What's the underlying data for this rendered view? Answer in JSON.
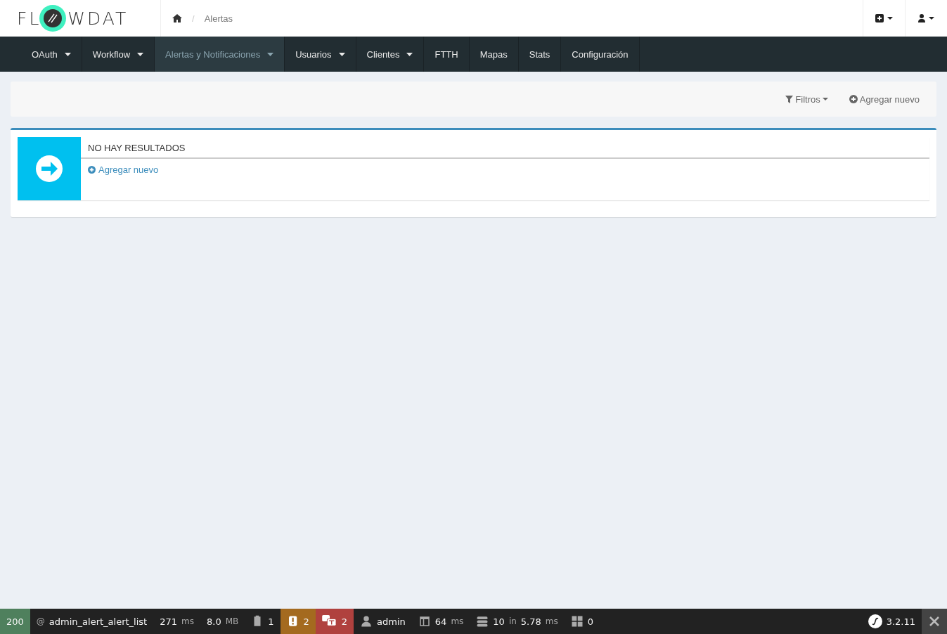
{
  "header": {
    "logo": {
      "before": "FL",
      "after": "WDAT"
    },
    "breadcrumb": [
      {
        "separator": "/",
        "label": "Alertas"
      }
    ]
  },
  "nav": [
    {
      "label": "OAuth",
      "dropdown": true,
      "selected": false
    },
    {
      "label": "Workflow",
      "dropdown": true,
      "selected": false
    },
    {
      "label": "Alertas y Notificaciones",
      "dropdown": true,
      "selected": true
    },
    {
      "label": "Usuarios",
      "dropdown": true,
      "selected": false
    },
    {
      "label": "Clientes",
      "dropdown": true,
      "selected": false
    },
    {
      "label": "FTTH",
      "dropdown": false,
      "selected": false
    },
    {
      "label": "Mapas",
      "dropdown": false,
      "selected": false
    },
    {
      "label": "Stats",
      "dropdown": false,
      "selected": false
    },
    {
      "label": "Configuración",
      "dropdown": false,
      "selected": false
    }
  ],
  "actions": {
    "filters": "Filtros",
    "add": "Agregar nuevo"
  },
  "empty": {
    "title": "NO HAY RESULTADOS",
    "link": "Agregar nuevo"
  },
  "toolbar": [
    {
      "kind": "status",
      "color": "#4f805d",
      "parts": [
        {
          "text": "200",
          "muted": false
        }
      ]
    },
    {
      "kind": "route",
      "parts": [
        {
          "text": "@",
          "muted": true
        },
        {
          "text": "admin_alert_alert_list",
          "muted": false
        }
      ]
    },
    {
      "kind": "time",
      "parts": [
        {
          "text": "271",
          "muted": false
        },
        {
          "text": "ms",
          "muted": true
        }
      ]
    },
    {
      "kind": "memory",
      "parts": [
        {
          "text": "8.0",
          "muted": false
        },
        {
          "text": "MB",
          "muted": true
        }
      ]
    },
    {
      "kind": "logs",
      "parts": [
        {
          "text": "1",
          "muted": false
        }
      ]
    },
    {
      "kind": "errors",
      "color": "#a46a1f",
      "parts": [
        {
          "text": "2",
          "muted": false
        }
      ]
    },
    {
      "kind": "translations",
      "color": "#b0413e",
      "parts": [
        {
          "text": "2",
          "muted": false
        }
      ]
    },
    {
      "kind": "user",
      "parts": [
        {
          "text": "admin",
          "muted": false
        }
      ]
    },
    {
      "kind": "render",
      "parts": [
        {
          "text": "64",
          "muted": false
        },
        {
          "text": "ms",
          "muted": true
        }
      ]
    },
    {
      "kind": "db",
      "parts": [
        {
          "text": "10",
          "muted": false
        },
        {
          "text": "in",
          "muted": true
        },
        {
          "text": "5.78",
          "muted": false
        },
        {
          "text": "ms",
          "muted": true
        }
      ]
    },
    {
      "kind": "twig",
      "parts": [
        {
          "text": "0",
          "muted": false
        }
      ]
    }
  ],
  "toolbar_version": "3.2.11"
}
